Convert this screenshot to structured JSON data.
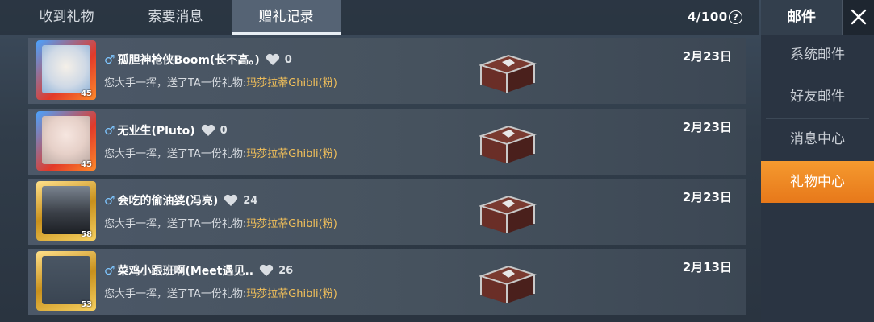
{
  "tabs": [
    {
      "label": "收到礼物"
    },
    {
      "label": "索要消息"
    },
    {
      "label": "赠礼记录",
      "active": true
    }
  ],
  "counter": "4/100",
  "help_icon": "question-circle-icon",
  "sidebar": {
    "title": "邮件",
    "close_icon": "close-icon",
    "items": [
      {
        "label": "系统邮件"
      },
      {
        "label": "好友邮件"
      },
      {
        "label": "消息中心"
      },
      {
        "label": "礼物中心",
        "active": true
      }
    ]
  },
  "colors": {
    "accent": "#f08a24",
    "gift_text": "#f4c15a",
    "gender_male": "#7fc6ff"
  },
  "records": [
    {
      "gender": "♂",
      "name": "孤胆神枪侠Boom(长不高。)",
      "likes": "0",
      "level": "45",
      "message_prefix": "您大手一挥，送了TA一份礼物:",
      "gift": "玛莎拉蒂Ghibli(粉)",
      "date": "2月23日"
    },
    {
      "gender": "♂",
      "name": "无业生(Pluto)",
      "likes": "0",
      "level": "45",
      "message_prefix": "您大手一挥，送了TA一份礼物:",
      "gift": "玛莎拉蒂Ghibli(粉)",
      "date": "2月23日"
    },
    {
      "gender": "♂",
      "name": "会吃的偷油婆(冯亮)",
      "likes": "24",
      "level": "58",
      "message_prefix": "您大手一挥，送了TA一份礼物:",
      "gift": "玛莎拉蒂Ghibli(粉)",
      "date": "2月23日"
    },
    {
      "gender": "♂",
      "name": "菜鸡小跟班啊(Meet遇见..",
      "likes": "26",
      "level": "53",
      "message_prefix": "您大手一挥，送了TA一份礼物:",
      "gift": "玛莎拉蒂Ghibli(粉)",
      "date": "2月13日"
    }
  ]
}
